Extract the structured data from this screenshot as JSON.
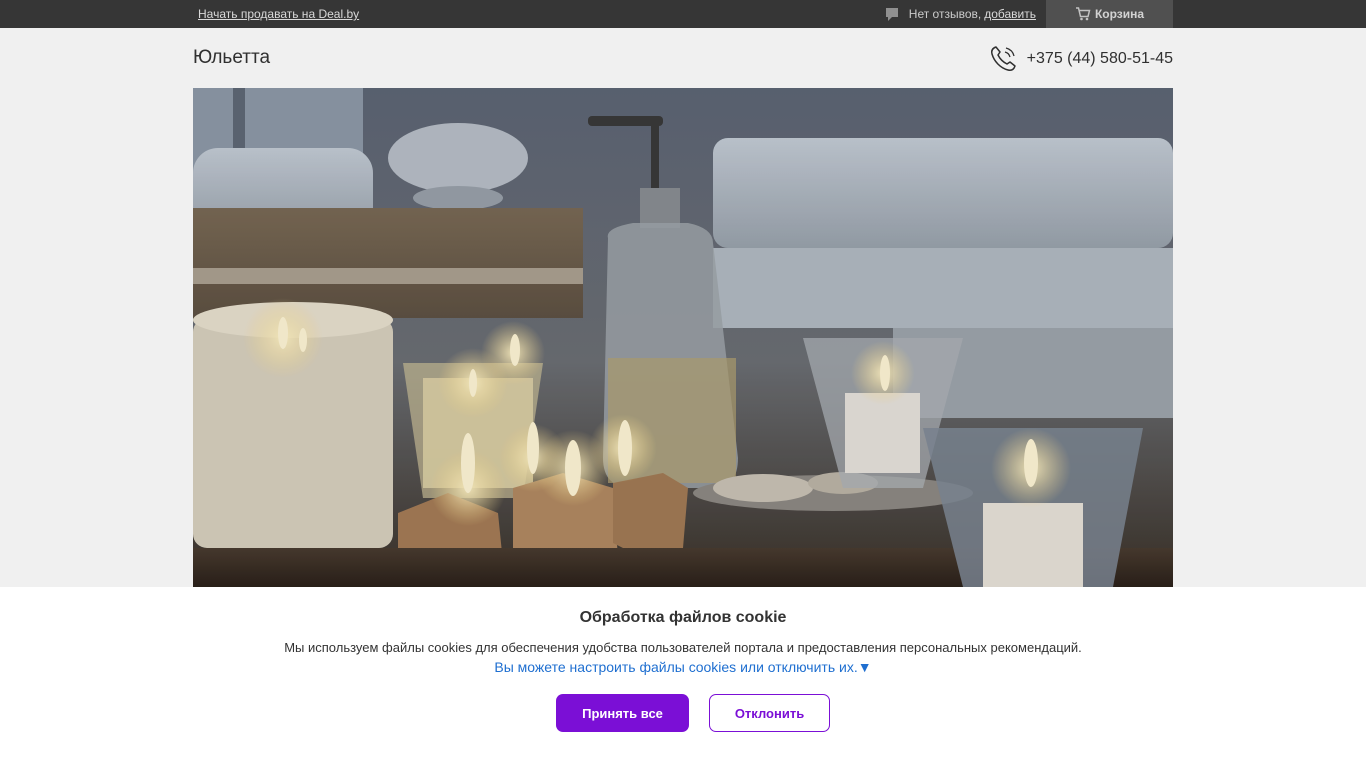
{
  "topbar": {
    "sell_link": "Начать продавать на Deal.by",
    "reviews_text": "Нет отзывов,",
    "reviews_add": "добавить",
    "cart_label": "Корзина",
    "icons": [
      "speech-bubble-icon",
      "cart-icon"
    ]
  },
  "header": {
    "shop_name": "Юльетта",
    "phone": "+375 (44) 580-51-45",
    "phone_icon": "phone-icon"
  },
  "hero": {
    "description_icon": "spa-candles-photo"
  },
  "cookie": {
    "title": "Обработка файлов cookie",
    "text": "Мы используем файлы cookies для обеспечения удобства пользователей портала и предоставления персональных рекомендаций.",
    "settings_link": "Вы можете настроить файлы cookies или отключить их.▼",
    "accept_label": "Принять все",
    "decline_label": "Отклонить"
  },
  "colors": {
    "accent": "#7b0fd6",
    "link": "#1f6fd0",
    "topbar_bg": "#3a3a3a",
    "cart_bg": "#555555"
  }
}
